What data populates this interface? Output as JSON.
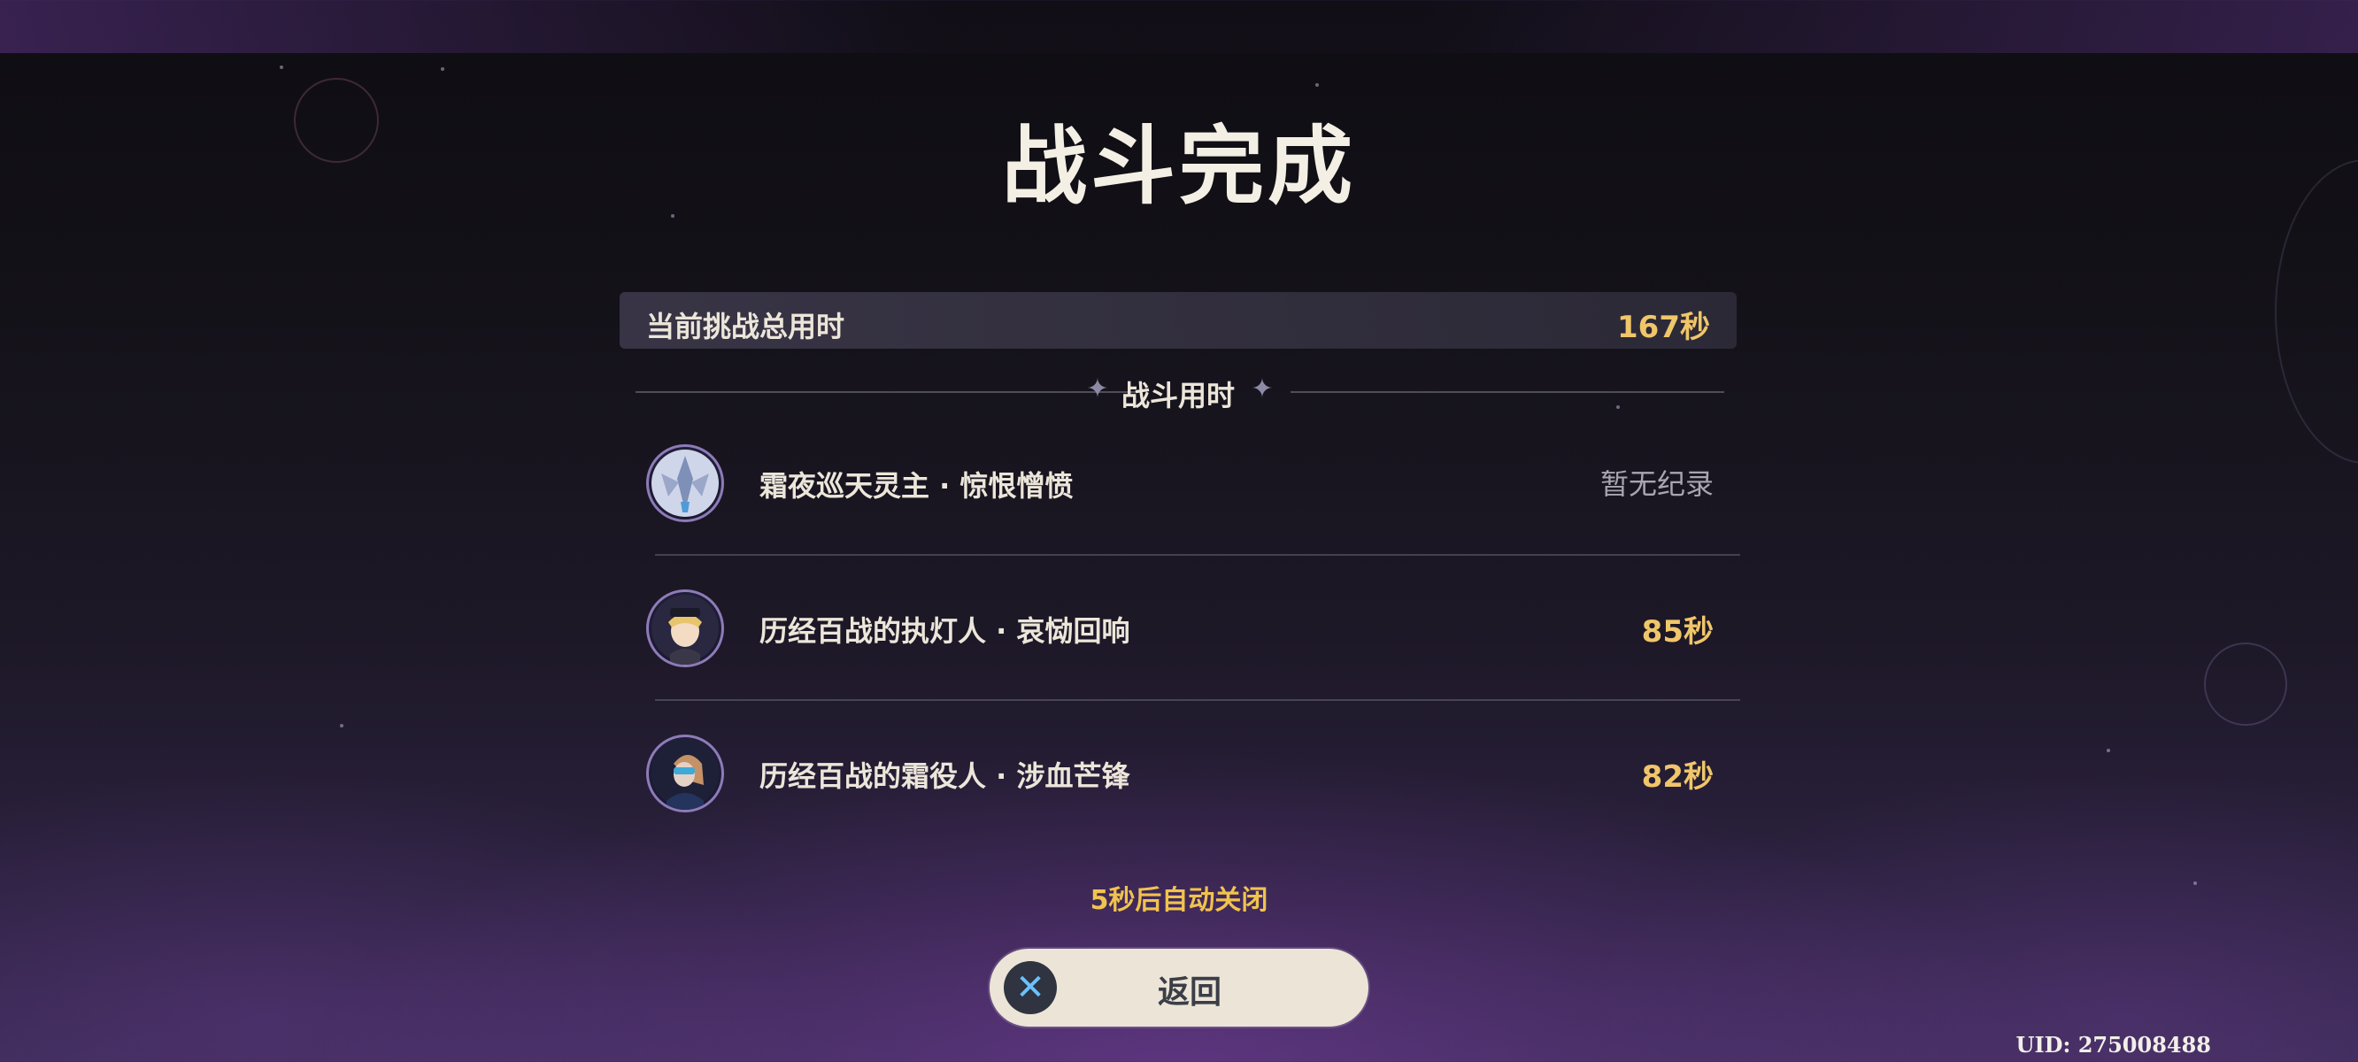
{
  "title": "战斗完成",
  "total": {
    "label": "当前挑战总用时",
    "value": "167秒"
  },
  "section": {
    "title": "战斗用时"
  },
  "rows": [
    {
      "name": "霜夜巡天灵主 · 惊恨憎愤",
      "value": "暂无纪录",
      "icon": "boss-crest-icon"
    },
    {
      "name": "历经百战的执灯人 · 哀恸回响",
      "value": "85秒",
      "icon": "lantern-bearer-portrait"
    },
    {
      "name": "历经百战的霜役人 · 涉血芒锋",
      "value": "82秒",
      "icon": "frost-operative-portrait"
    }
  ],
  "auto_close": "5秒后自动关闭",
  "back_button": {
    "label": "返回",
    "icon": "close-x-icon"
  },
  "uid": "UID: 275008488",
  "colors": {
    "accent_gold": "#f0c66a",
    "button_bg": "#ece5d7",
    "icon_blue": "#6cc1ff"
  }
}
